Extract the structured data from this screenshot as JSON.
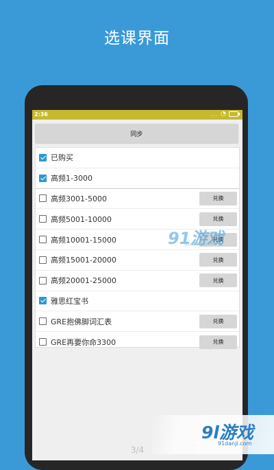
{
  "header": {
    "title": "选课界面"
  },
  "status_bar": {
    "time": "2:36",
    "signal": "...",
    "colors": {
      "bar": "#c7b92d"
    }
  },
  "toolbar": {
    "sync_label": "同步"
  },
  "courses": [
    {
      "label": "已购买",
      "checked": true,
      "redeem_label": ""
    },
    {
      "label": "高频1-3000",
      "checked": true,
      "redeem_label": ""
    },
    {
      "label": "高频3001-5000",
      "checked": false,
      "redeem_label": "兑换"
    },
    {
      "label": "高频5001-10000",
      "checked": false,
      "redeem_label": "兑换"
    },
    {
      "label": "高频10001-15000",
      "checked": false,
      "redeem_label": "兑换"
    },
    {
      "label": "高频15001-20000",
      "checked": false,
      "redeem_label": "兑换"
    },
    {
      "label": "高频20001-25000",
      "checked": false,
      "redeem_label": "兑换"
    },
    {
      "label": "雅思红宝书",
      "checked": true,
      "redeem_label": ""
    },
    {
      "label": "GRE抱佛脚词汇表",
      "checked": false,
      "redeem_label": "兑换"
    },
    {
      "label": "GRE再要你命3300",
      "checked": false,
      "redeem_label": "兑换"
    }
  ],
  "pager": {
    "indicator": "3/4"
  },
  "watermarks": {
    "center_logo": "91游戏",
    "center_url": "91danji.com",
    "corner_logo": "9l游戏",
    "corner_url": "91danji.com"
  },
  "colors": {
    "background": "#3a9ad8",
    "accent": "#2b9ad6"
  },
  "icons": [
    "wifi-icon",
    "battery-icon",
    "checkbox-icon"
  ]
}
